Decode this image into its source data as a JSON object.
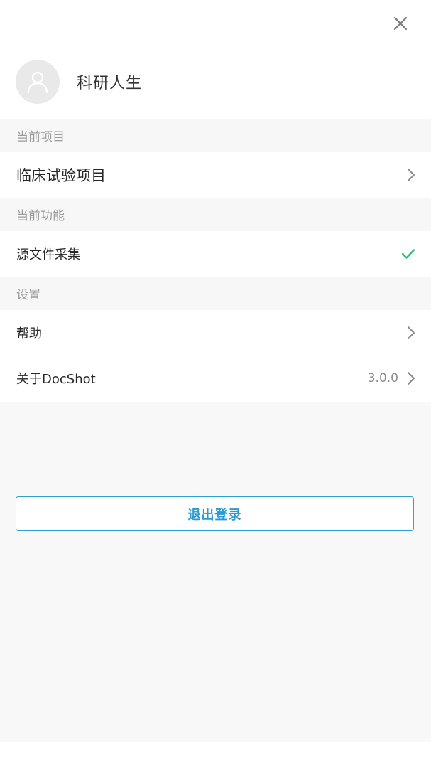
{
  "header": {
    "close_icon": "close-icon",
    "username": "科研人生",
    "avatar_icon": "user-avatar-icon"
  },
  "sections": {
    "current_project": {
      "header": "当前项目",
      "item": "临床试验项目"
    },
    "current_function": {
      "header": "当前功能",
      "item": "源文件采集"
    },
    "settings": {
      "header": "设置",
      "help": "帮助",
      "about": "关于DocShot",
      "version": "3.0.0"
    }
  },
  "logout_label": "退出登录",
  "colors": {
    "accent": "#2a9ad2",
    "check": "#3cb87a",
    "section_bg": "#f7f7f7",
    "muted_text": "#9a9a9a"
  }
}
